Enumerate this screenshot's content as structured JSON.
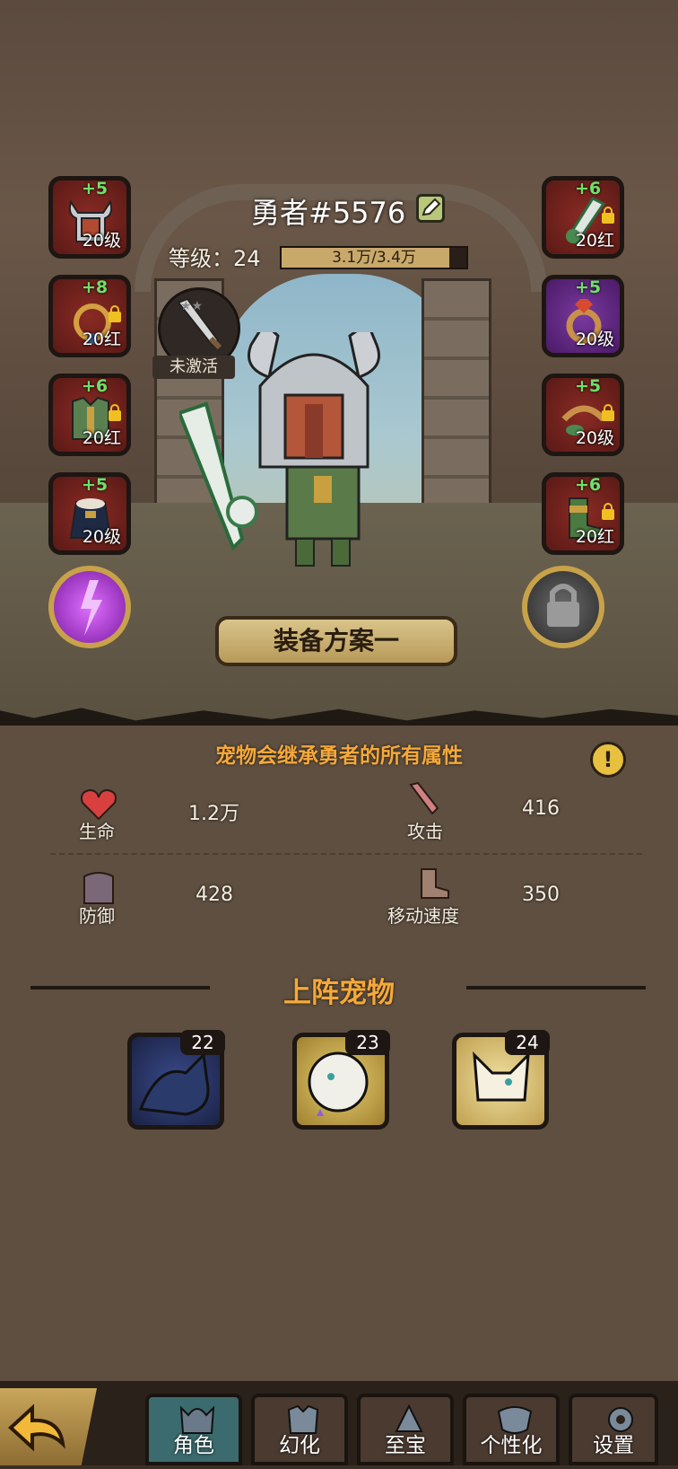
{
  "hero": {
    "name": "勇者#5576",
    "level_label": "等级：",
    "level_value": "24",
    "xp_text": "3.1万/3.4万",
    "xp_fraction": 0.91
  },
  "weapon": {
    "status": "未激活"
  },
  "left_slots": [
    {
      "plus": "+5",
      "level": "20级",
      "locked": false
    },
    {
      "plus": "+8",
      "level": "20红",
      "locked": true
    },
    {
      "plus": "+6",
      "level": "20红",
      "locked": true
    },
    {
      "plus": "+5",
      "level": "20级",
      "locked": false
    }
  ],
  "right_slots": [
    {
      "plus": "+6",
      "level": "20红",
      "locked": true
    },
    {
      "plus": "+5",
      "level": "20级",
      "locked": false
    },
    {
      "plus": "+5",
      "level": "20级",
      "locked": true
    },
    {
      "plus": "+6",
      "level": "20红",
      "locked": true
    }
  ],
  "scheme_button": "装备方案一",
  "inherit_text": "宠物会继承勇者的所有属性",
  "info_icon": "!",
  "stats": {
    "hp": {
      "label": "生命",
      "value": "1.2万"
    },
    "atk": {
      "label": "攻击",
      "value": "416"
    },
    "def": {
      "label": "防御",
      "value": "428"
    },
    "spd": {
      "label": "移动速度",
      "value": "350"
    }
  },
  "pets_title": "上阵宠物",
  "pets": [
    {
      "level": "22"
    },
    {
      "level": "23"
    },
    {
      "level": "24"
    }
  ],
  "nav": {
    "tabs": [
      "角色",
      "幻化",
      "至宝",
      "个性化",
      "设置"
    ]
  },
  "colors": {
    "accent_orange": "#f5a93a",
    "plus_green": "#6fe06a",
    "active_tab": "#3b6b6e"
  }
}
